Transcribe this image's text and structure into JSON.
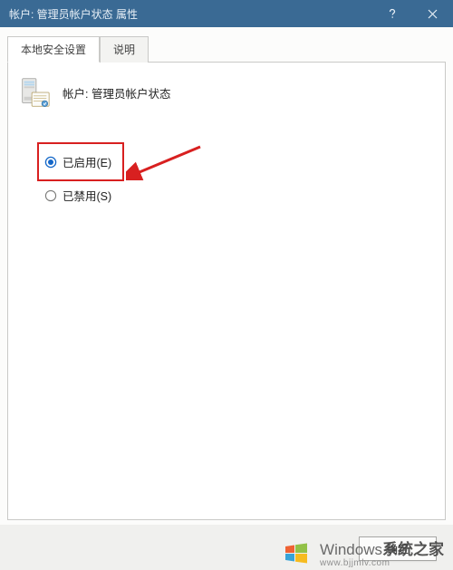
{
  "window": {
    "title": "帐户: 管理员帐户状态 属性"
  },
  "tabs": {
    "security": "本地安全设置",
    "explain": "说明"
  },
  "policy": {
    "label": "帐户: 管理员帐户状态"
  },
  "options": {
    "enabled": "已启用(E)",
    "disabled": "已禁用(S)"
  },
  "buttons": {
    "ok": "确定"
  },
  "watermark": {
    "brand_prefix": "Windows",
    "brand_suffix": "系统之家",
    "url": "www.bjjmlv.com"
  }
}
